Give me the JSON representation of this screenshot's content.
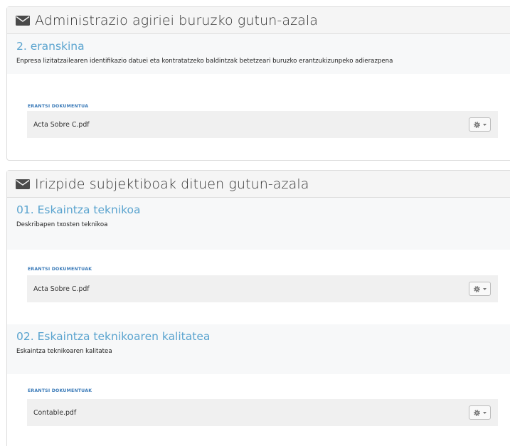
{
  "panels": [
    {
      "title": "Administrazio agiriei buruzko gutun-azala",
      "sections": [
        {
          "title": "2. eranskina",
          "description": "Enpresa lizitatzailearen identifikazio datuei eta kontratatzeko baldintzak betetzeari buruzko erantzukizunpeko adierazpena",
          "doc_label": "ERANTSI DOKUMENTUA",
          "file": "Acta Sobre C.pdf"
        }
      ]
    },
    {
      "title": "Irizpide subjektiboak dituen gutun-azala",
      "sections": [
        {
          "title": "01. Eskaintza teknikoa",
          "description": "Deskribapen txosten teknikoa",
          "doc_label": "ERANTSI DOKUMENTUAK",
          "file": "Acta Sobre C.pdf"
        },
        {
          "title": "02. Eskaintza teknikoaren kalitatea",
          "description": "Eskaintza teknikoaren kalitatea",
          "doc_label": "ERANTSI DOKUMENTUAK",
          "file": "Contable.pdf"
        }
      ]
    }
  ],
  "icons": {
    "panel_heading": "envelope-icon",
    "file_actions": "gear-icon",
    "dropdown": "caret-down-icon"
  },
  "colors": {
    "section_title": "#5ba4cf",
    "doc_label": "#3a7ab8",
    "heading_bg": "#f5f5f5",
    "doc_row_bg": "#f0f0f0"
  }
}
